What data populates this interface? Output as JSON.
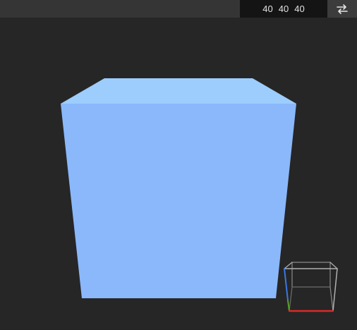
{
  "toolbar": {
    "dimensions": [
      "40",
      "40",
      "40"
    ],
    "swap_icon": "swap-arrows-icon"
  },
  "scene": {
    "cube_colors": {
      "top": "#9ccdfd",
      "front": "#8ab8fb"
    },
    "background": "#262626"
  },
  "gizmo": {
    "axis_colors": {
      "x": "#d92a2a",
      "y": "#5aa02c",
      "z": "#3a78e0"
    }
  }
}
